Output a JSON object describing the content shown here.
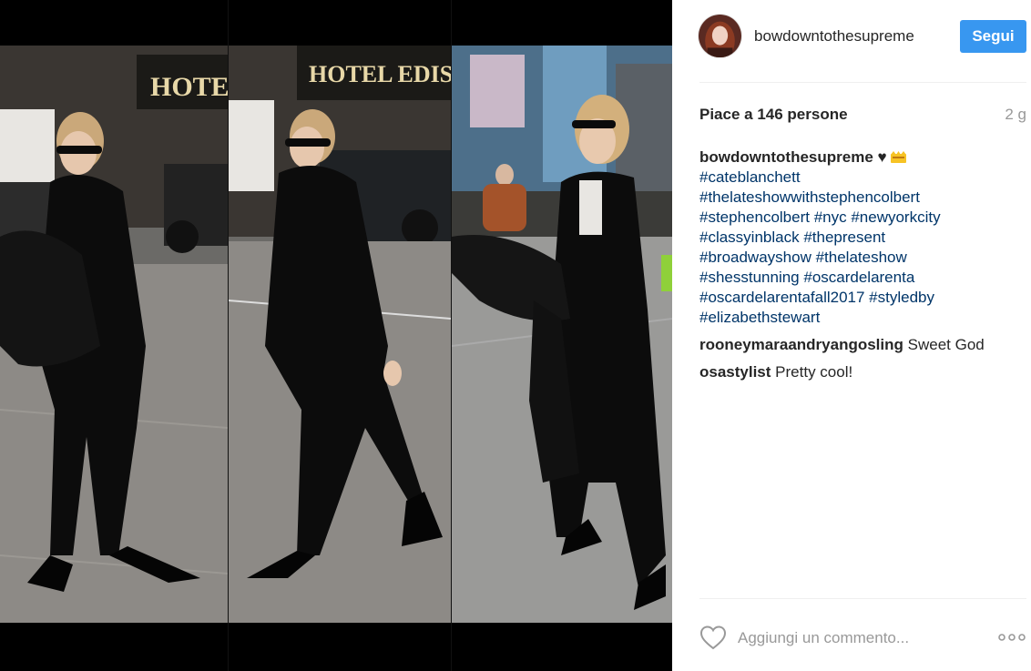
{
  "header": {
    "username": "bowdowntothesupreme",
    "follow_label": "Segui"
  },
  "likes": {
    "text": "Piace a 146 persone",
    "timestamp": "2 g"
  },
  "caption": {
    "user": "bowdowntothesupreme",
    "text": "♥",
    "hashtag_lines": [
      "#cateblanchett",
      "#thelateshowwithstephencolbert",
      "#stephencolbert #nyc #newyorkcity",
      "#classyinblack #thepresent",
      "#broadwayshow #thelateshow",
      "#shesstunning #oscardelarenta",
      "#oscardelarentafall2017 #styledby",
      "#elizabethstewart"
    ]
  },
  "comments": [
    {
      "user": "rooneymaraandryangosling",
      "text": "Sweet God"
    },
    {
      "user": "osastylist",
      "text": "Pretty cool!"
    }
  ],
  "comment_bar": {
    "placeholder": "Aggiungi un commento..."
  },
  "media": {
    "sign_1": "HOTEL E",
    "sign_2": "HOTEL EDISON"
  },
  "colors": {
    "follow_button": "#3897f0",
    "hashtag": "#003569",
    "muted": "#999999",
    "separator": "#efefef"
  },
  "icons": [
    "heart-icon",
    "more-options-icon",
    "crown-icon"
  ]
}
